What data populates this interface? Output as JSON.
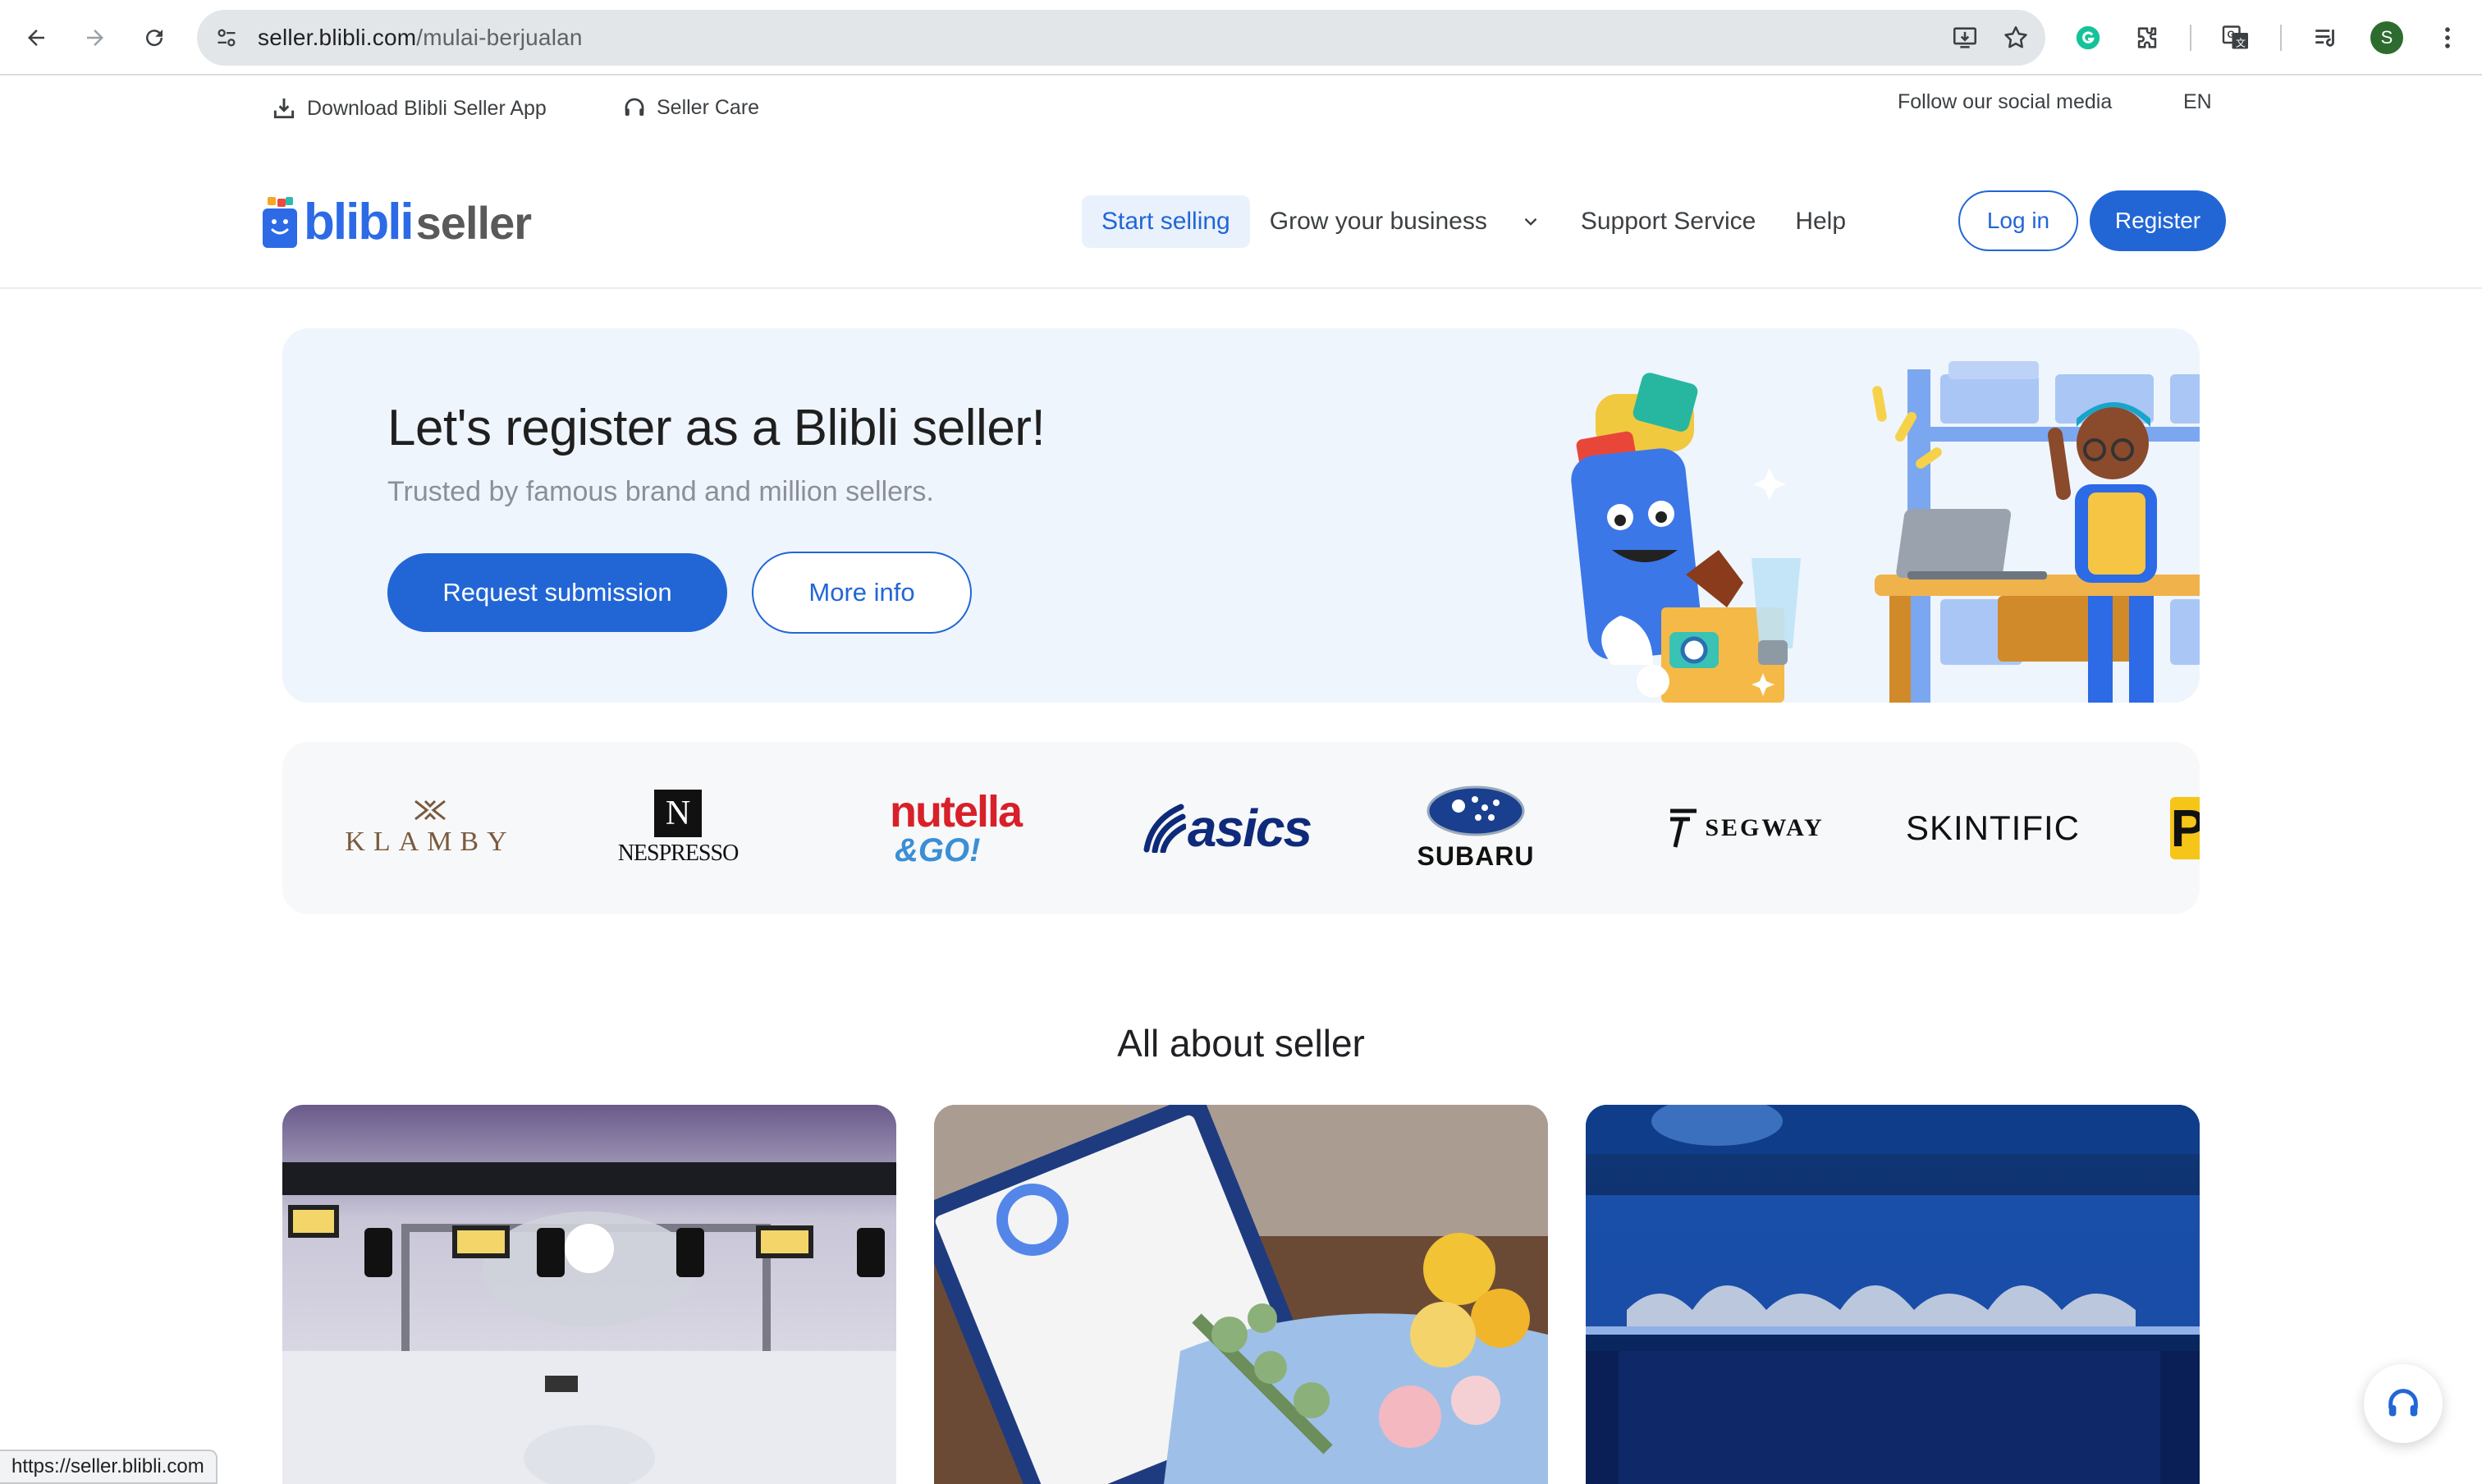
{
  "browser": {
    "url_host": "seller.blibli.com",
    "url_path": "/mulai-berjualan",
    "avatar_initial": "S",
    "status_url": "https://seller.blibli.com"
  },
  "utility": {
    "download_app": "Download Blibli Seller App",
    "seller_care": "Seller Care",
    "follow_social": "Follow our social media",
    "language": "EN"
  },
  "header": {
    "logo_brand": "blibli",
    "logo_suffix": "seller",
    "menu": [
      {
        "label": "Start selling",
        "active": true
      },
      {
        "label": "Grow your business",
        "active": false
      },
      {
        "label": "Support Service",
        "active": false
      },
      {
        "label": "Help",
        "active": false
      }
    ],
    "login": "Log in",
    "register": "Register"
  },
  "hero": {
    "title": "Let's register as a Blibli seller!",
    "subtitle": "Trusted by famous brand and million sellers.",
    "primary_cta": "Request submission",
    "secondary_cta": "More info"
  },
  "brands": [
    {
      "name": "KLAMBY",
      "icon": "klamby-logo"
    },
    {
      "name": "NESPRESSO",
      "icon": "nespresso-logo"
    },
    {
      "name": "nutella",
      "sub": "&GO!",
      "icon": "nutella-logo"
    },
    {
      "name": "asics",
      "icon": "asics-logo"
    },
    {
      "name": "SUBARU",
      "icon": "subaru-logo"
    },
    {
      "name": "SEGWAY",
      "icon": "segway-logo"
    },
    {
      "name": "SKINTIFIC",
      "icon": "skintific-logo"
    },
    {
      "name": "P",
      "icon": "partial-brand-logo"
    }
  ],
  "about": {
    "title": "All about seller"
  },
  "colors": {
    "primary": "#2266d6",
    "hero_bg": "#eff5fc",
    "brands_bg": "#f7f8f9"
  }
}
